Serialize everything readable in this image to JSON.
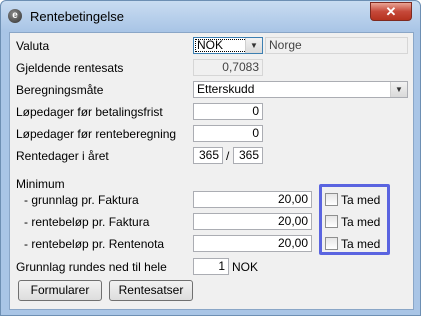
{
  "window": {
    "title": "Rentebetingelse",
    "close_glyph": "✕",
    "app_icon_glyph": "e"
  },
  "fields": {
    "valuta_label": "Valuta",
    "valuta_code": "NOK",
    "valuta_name": "Norge",
    "rentesats_label": "Gjeldende rentesats",
    "rentesats_value": "0,7083",
    "beregningsmate_label": "Beregningsmåte",
    "beregningsmate_value": "Etterskudd",
    "lopedager_betaling_label": "Løpedager før betalingsfrist",
    "lopedager_betaling_value": "0",
    "lopedager_rente_label": "Løpedager før renteberegning",
    "lopedager_rente_value": "0",
    "rentedager_label": "Rentedager i året",
    "rentedager_value1": "365",
    "rentedager_sep": "/",
    "rentedager_value2": "365"
  },
  "minimum": {
    "heading": "Minimum",
    "rows": [
      {
        "label": "- grunnlag pr. Faktura",
        "value": "20,00",
        "check_label": "Ta med",
        "checked": false
      },
      {
        "label": "- rentebeløp pr. Faktura",
        "value": "20,00",
        "check_label": "Ta med",
        "checked": false
      },
      {
        "label": "- rentebeløp pr. Rentenota",
        "value": "20,00",
        "check_label": "Ta med",
        "checked": false
      }
    ]
  },
  "rounding": {
    "label": "Grunnlag rundes ned til hele",
    "value": "1",
    "unit": "NOK"
  },
  "buttons": {
    "formularer": "Formularer",
    "rentesatser": "Rentesatser"
  },
  "colors": {
    "highlight": "#5a64e0",
    "close_button": "#c6493a",
    "title_bar": "#a9c5e6"
  }
}
